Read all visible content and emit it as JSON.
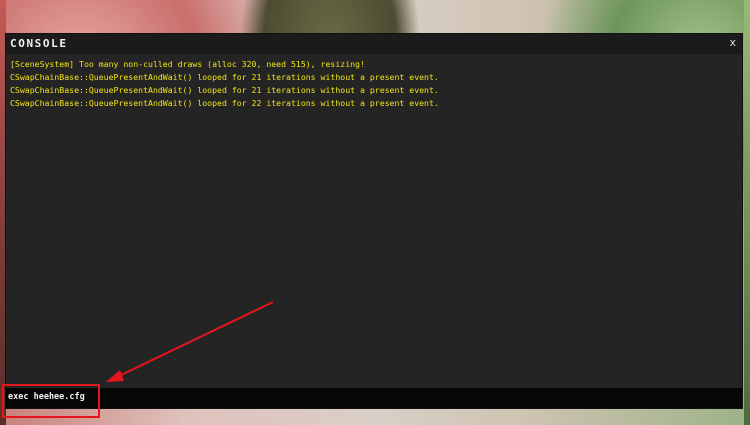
{
  "console": {
    "title": "CONSOLE",
    "close_label": "x",
    "log_lines": [
      "[SceneSystem] Too many non-culled draws (alloc 320, need 515), resizing!",
      "CSwapChainBase::QueuePresentAndWait() looped for 21 iterations without a present event.",
      "CSwapChainBase::QueuePresentAndWait() looped for 21 iterations without a present event.",
      "CSwapChainBase::QueuePresentAndWait() looped for 22 iterations without a present event."
    ],
    "input_value": "exec heehee.cfg"
  },
  "colors": {
    "log_text": "#f2e418",
    "annotation": "#e3161b"
  },
  "icons": {
    "close": "close-icon",
    "annotation_arrow": "arrow-icon"
  }
}
